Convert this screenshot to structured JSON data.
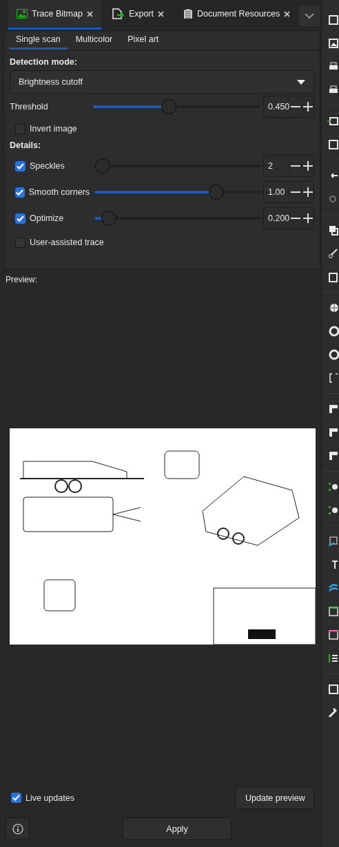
{
  "tabs": [
    {
      "kind": "trace",
      "label": "Trace Bitmap",
      "selected": true
    },
    {
      "kind": "export",
      "label": "Export",
      "selected": false
    },
    {
      "kind": "resources",
      "label": "Document Resources",
      "selected": false
    }
  ],
  "subtabs": [
    {
      "label": "Single scan",
      "selected": true
    },
    {
      "label": "Multicolor",
      "selected": false
    },
    {
      "label": "Pixel art",
      "selected": false
    }
  ],
  "detection_mode": {
    "label": "Detection mode:",
    "value": "Brightness cutoff"
  },
  "threshold": {
    "label": "Threshold",
    "level": 0.45,
    "value": "0.450"
  },
  "invert_image": {
    "label": "Invert image",
    "checked": false
  },
  "details": {
    "label": "Details:",
    "rows": [
      {
        "kind": "slider",
        "label": "Speckles",
        "checked": true,
        "level": 0,
        "value": "2"
      },
      {
        "kind": "slider",
        "label": "Smooth corners",
        "checked": true,
        "level": 0.75,
        "value": "1.00"
      },
      {
        "kind": "slider",
        "label": "Optimize",
        "checked": true,
        "level": 0.04,
        "value": "0.200"
      },
      {
        "kind": "check",
        "label": "User-assisted trace",
        "checked": false
      }
    ]
  },
  "preview": {
    "label": "Preview:",
    "kind": "picture"
  },
  "live_updates": {
    "label": "Live updates",
    "checked": true
  },
  "buttons": {
    "update_preview": "Update preview",
    "apply": "Apply"
  }
}
